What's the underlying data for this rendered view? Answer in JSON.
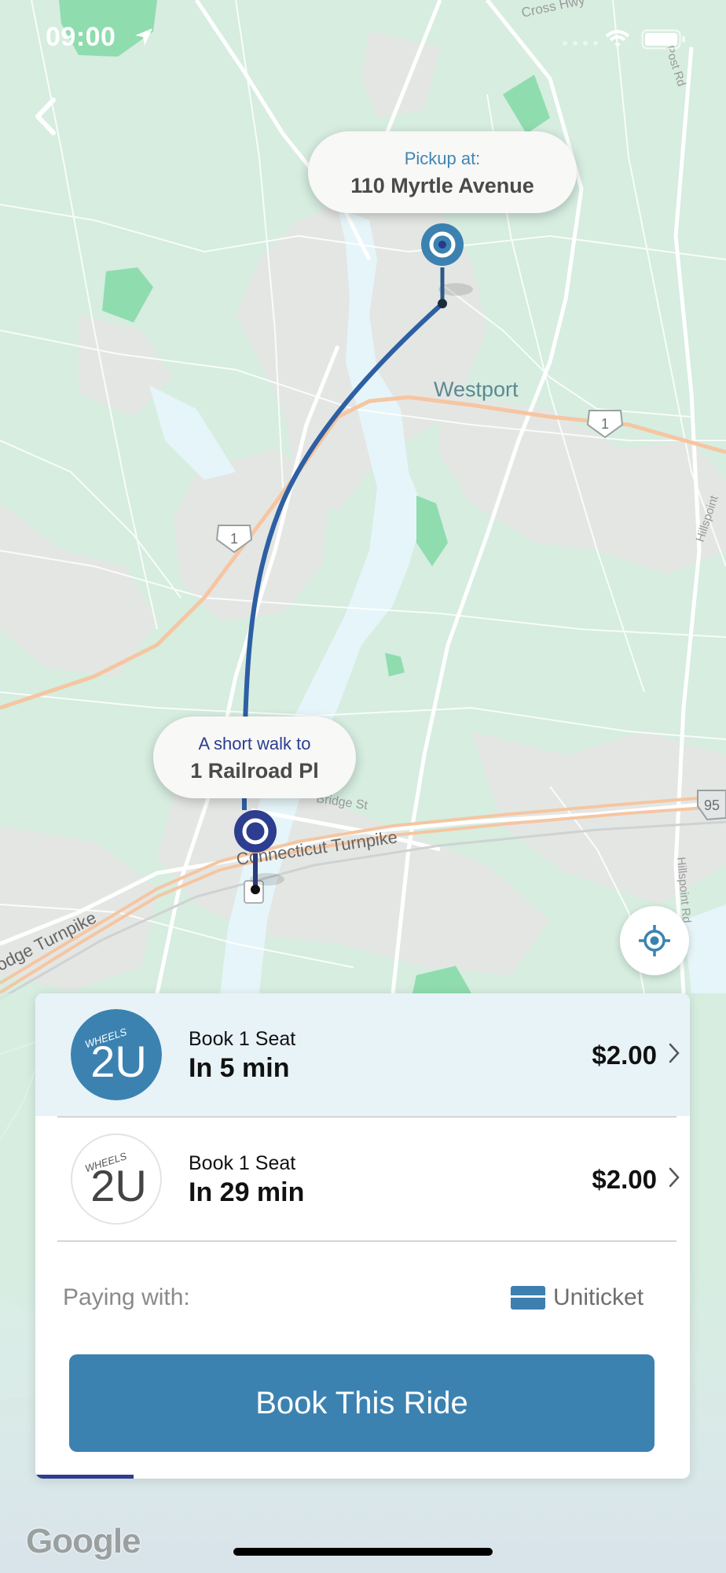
{
  "status_bar": {
    "time": "09:00"
  },
  "map": {
    "labels": {
      "town": "Westport",
      "highway_1": "1",
      "highway_95": "95",
      "road_cross_hwy": "Cross Hwy",
      "road_post_rd": "Post Rd",
      "road_bridge_st": "Bridge St",
      "road_ct_turnpike": "Connecticut Turnpike",
      "road_turnpike_left": "odge Turnpike",
      "road_hillspoint_top": "Hillspoint",
      "road_hillspoint_rd": "Hillspoint Rd"
    },
    "pickup_callout": {
      "label": "Pickup at:",
      "address": "110 Myrtle Avenue"
    },
    "dropoff_callout": {
      "label": "A short walk to",
      "address": "1 Railroad Pl"
    }
  },
  "sheet": {
    "options": [
      {
        "seats_label": "Book 1 Seat",
        "eta": "In 5 min",
        "price": "$2.00",
        "logo_text_top": "WHEELS",
        "logo_text_big": "2U",
        "selected": true
      },
      {
        "seats_label": "Book 1 Seat",
        "eta": "In 29 min",
        "price": "$2.00",
        "logo_text_top": "WHEELS",
        "logo_text_big": "2U",
        "selected": false
      }
    ],
    "paying_with_label": "Paying with:",
    "payment_method": "Uniticket",
    "book_button_label": "Book This Ride",
    "progress_fraction": 0.15
  },
  "google_logo": "Google",
  "colors": {
    "accent": "#3c82b1",
    "route_line": "#2d5fa3",
    "dark_blue": "#2d3d8f",
    "selected_row": "#e8f3f8"
  },
  "icons": {
    "back": "chevron-left-icon",
    "location_arrow": "location-arrow-icon",
    "wifi": "wifi-icon",
    "battery": "battery-icon",
    "locate": "crosshair-locate-icon",
    "chevron": "chevron-right-icon",
    "card": "card-icon",
    "pin": "map-pin-icon"
  }
}
